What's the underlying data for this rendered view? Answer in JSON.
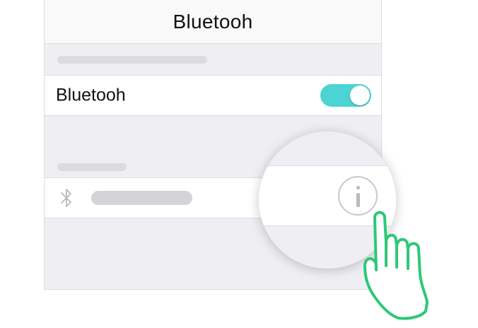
{
  "navbar": {
    "title": "Bluetooh"
  },
  "settings": {
    "bluetooth_row": {
      "label": "Bluetooh",
      "toggle_on": true
    },
    "device_row": {
      "icon": "bluetooth-icon"
    }
  },
  "magnifier": {
    "icon": "info-icon"
  },
  "gesture": {
    "icon": "pointing-hand-icon"
  },
  "colors": {
    "toggle_on": "#4cd3d3",
    "hand_outline": "#2dc978",
    "background": "#efeff3"
  }
}
